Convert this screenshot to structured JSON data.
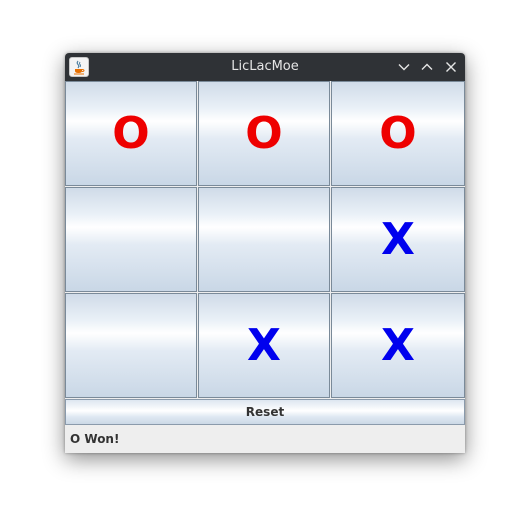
{
  "window": {
    "title": "LicLacMoe"
  },
  "board": {
    "cells": [
      {
        "mark": "O",
        "player": "o"
      },
      {
        "mark": "O",
        "player": "o"
      },
      {
        "mark": "O",
        "player": "o"
      },
      {
        "mark": "",
        "player": ""
      },
      {
        "mark": "",
        "player": ""
      },
      {
        "mark": "X",
        "player": "x"
      },
      {
        "mark": "",
        "player": ""
      },
      {
        "mark": "X",
        "player": "x"
      },
      {
        "mark": "X",
        "player": "x"
      }
    ],
    "colors": {
      "o": "#ee0000",
      "x": "#0000ee"
    }
  },
  "controls": {
    "reset_label": "Reset"
  },
  "status": {
    "text": "O Won!"
  },
  "icons": {
    "app": "java-cup-icon",
    "minimize": "chevron-down-icon",
    "maximize": "chevron-up-icon",
    "close": "close-icon"
  }
}
